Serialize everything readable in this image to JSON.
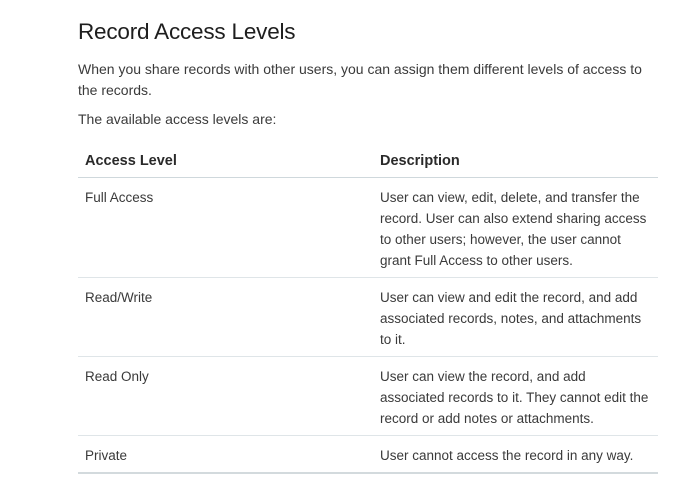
{
  "document": {
    "title": "Record Access Levels",
    "intro": "When you share records with other users, you can assign them different levels of access to the records.",
    "available_text": "The available access levels are:"
  },
  "table": {
    "headers": {
      "access_level": "Access Level",
      "description": "Description"
    },
    "rows": [
      {
        "level": "Full Access",
        "description": "User can view, edit, delete, and transfer the record. User can also extend sharing access to other users; however, the user cannot grant Full Access to other users."
      },
      {
        "level": "Read/Write",
        "description": "User can view and edit the record, and add associated records, notes, and attachments to it."
      },
      {
        "level": "Read Only",
        "description": "User can view the record, and add associated records to it. They cannot edit the record or add notes or attachments."
      },
      {
        "level": "Private",
        "description": "User cannot access the record in any way."
      }
    ]
  }
}
